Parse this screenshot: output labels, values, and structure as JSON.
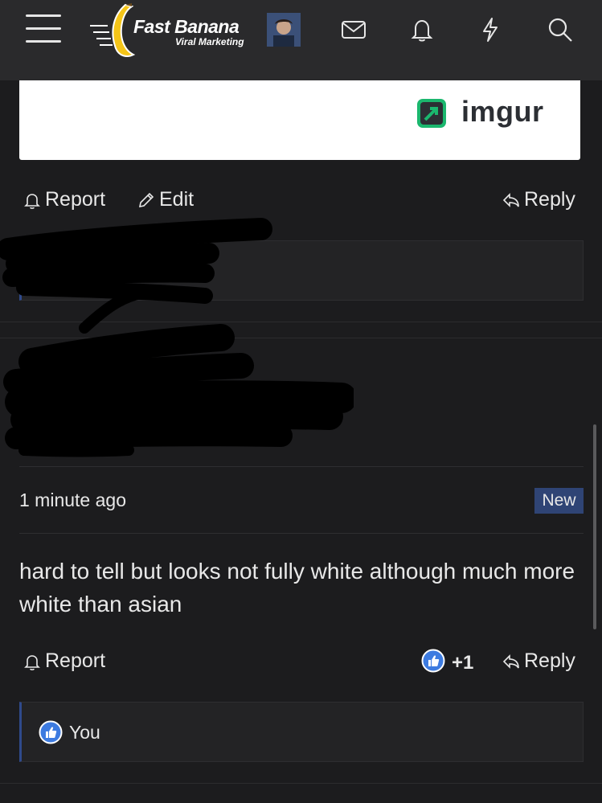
{
  "header": {
    "brand_name": "Fast Banana",
    "brand_tagline": "Viral Marketing",
    "icons": [
      "menu-icon",
      "envelope-icon",
      "bell-icon",
      "bolt-icon",
      "search-icon"
    ]
  },
  "embed": {
    "brand": "imgur"
  },
  "post1": {
    "actions": {
      "report": "Report",
      "edit": "Edit",
      "reply": "Reply"
    }
  },
  "post2": {
    "timestamp": "1 minute ago",
    "badge": "New",
    "message": "hard to tell but looks not fully white although much more white than asian",
    "actions": {
      "report": "Report",
      "reply": "Reply"
    },
    "reaction_count": "+1",
    "reactions_by": "You"
  },
  "colors": {
    "background": "#1c1c1e",
    "topbar": "#2a2a2c",
    "accent": "#2f4475",
    "like": "#3d7be0",
    "banana": "#f5c518"
  }
}
